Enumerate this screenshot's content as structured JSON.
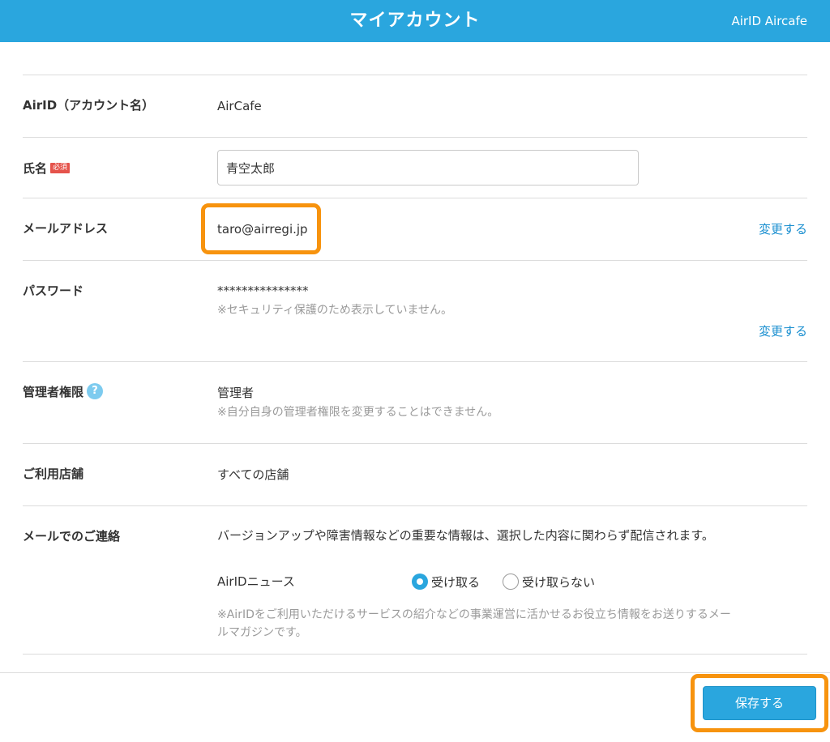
{
  "header": {
    "title": "マイアカウント",
    "account": "AirID Aircafe"
  },
  "colors": {
    "header_bg": "#2aa6de",
    "link": "#1a8fd0",
    "highlight": "#f7930e",
    "required_badge": "#e5534b"
  },
  "rows": {
    "airid": {
      "label": "AirID（アカウント名）",
      "value": "AirCafe"
    },
    "name": {
      "label": "氏名",
      "required_badge": "必須",
      "value": "青空太郎"
    },
    "email": {
      "label": "メールアドレス",
      "value": "taro@airregi.jp",
      "link": "変更する"
    },
    "password": {
      "label": "パスワード",
      "value": "***************",
      "note": "※セキュリティ保護のため表示していません。",
      "link": "変更する"
    },
    "admin": {
      "label": "管理者権限",
      "help_icon": "help-icon",
      "value": "管理者",
      "note": "※自分自身の管理者権限を変更することはできません。"
    },
    "stores": {
      "label": "ご利用店舗",
      "value": "すべての店舗"
    },
    "mail_contact": {
      "label": "メールでのご連絡",
      "description": "バージョンアップや障害情報などの重要な情報は、選択した内容に関わらず配信されます。",
      "newsletter_label": "AirIDニュース",
      "option_receive": "受け取る",
      "option_not_receive": "受け取らない",
      "selected": "受け取る",
      "note_line1": "※AirIDをご利用いただけるサービスの紹介などの事業運営に活かせるお役立ち情報をお送りするメー",
      "note_line2": "ルマガジンです。"
    }
  },
  "footer": {
    "save_label": "保存する"
  }
}
